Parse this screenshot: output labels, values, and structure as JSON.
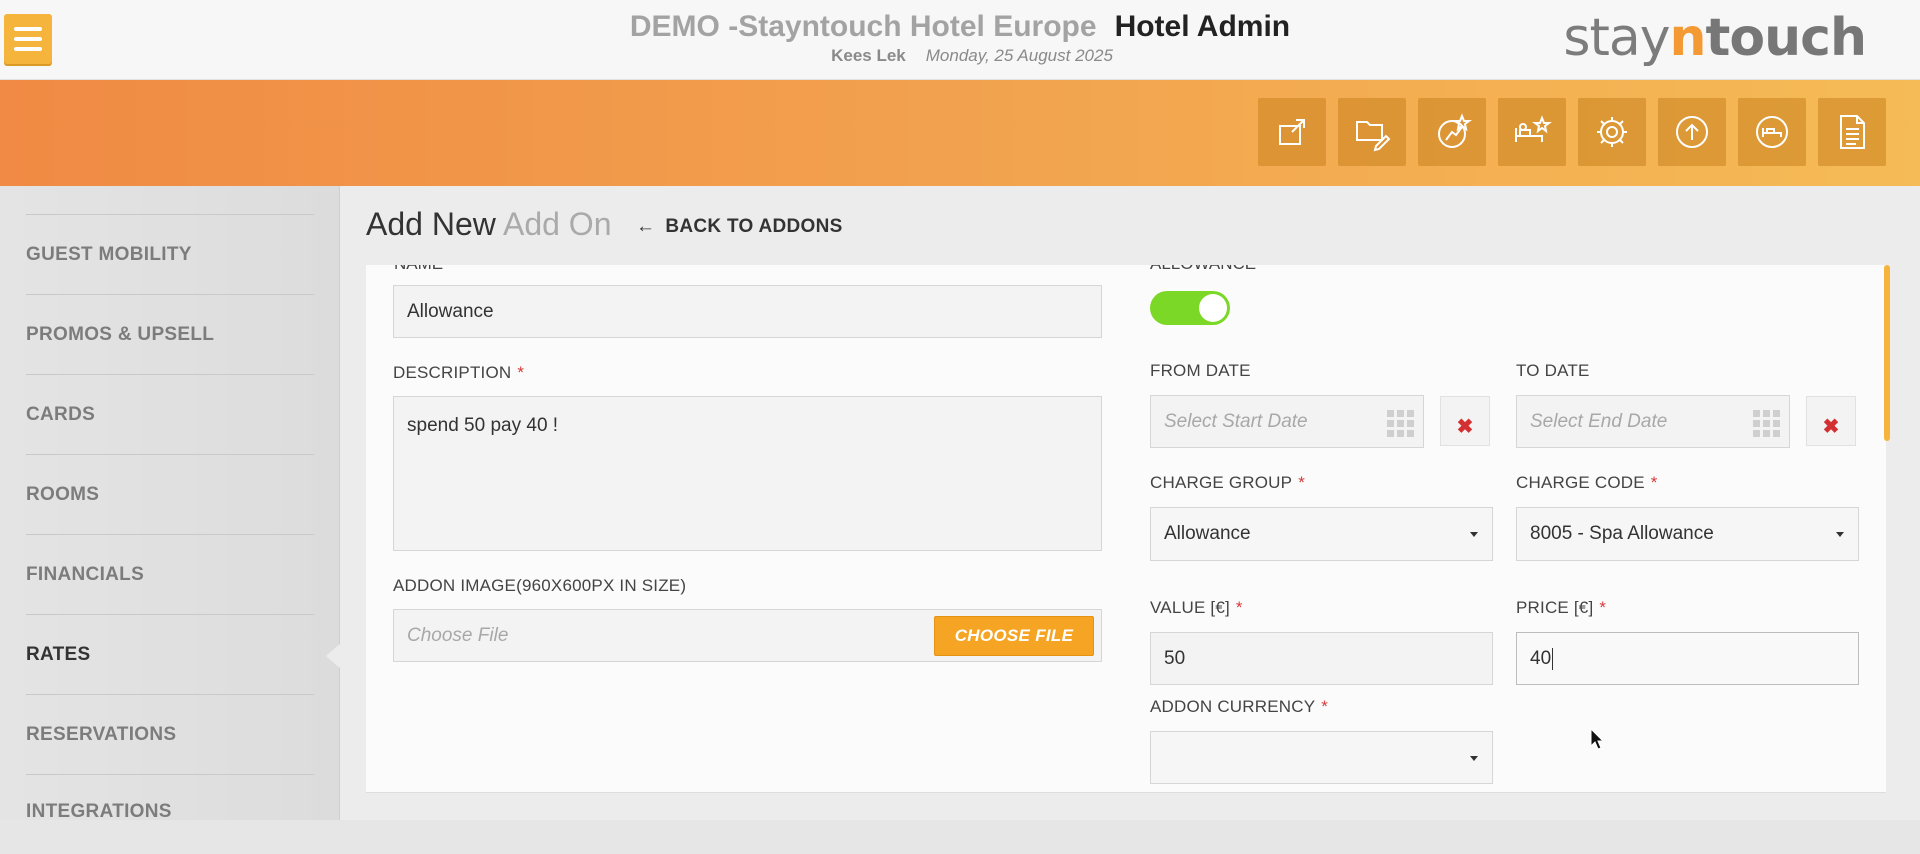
{
  "header": {
    "hotel_name": "DEMO -Stayntouch Hotel Europe",
    "app_name": "Hotel Admin",
    "user": "Kees Lek",
    "date": "Monday, 25 August 2025",
    "brand_pre": "stay",
    "brand_accent": "n",
    "brand_post": "touch"
  },
  "toolbar": {
    "icons": [
      "external-link-icon",
      "folder-edit-icon",
      "star-chart-icon",
      "bed-star-icon",
      "gear-icon",
      "upload-icon",
      "bed-circle-icon",
      "document-icon"
    ]
  },
  "sidebar": {
    "items": [
      {
        "label": "GUEST MOBILITY"
      },
      {
        "label": "PROMOS & UPSELL"
      },
      {
        "label": "CARDS"
      },
      {
        "label": "ROOMS"
      },
      {
        "label": "FINANCIALS"
      },
      {
        "label": "RATES"
      },
      {
        "label": "RESERVATIONS"
      },
      {
        "label": "INTEGRATIONS"
      }
    ],
    "active": "RATES"
  },
  "page": {
    "title_main": "Add New",
    "title_sub": "Add On",
    "back_label": "BACK TO ADDONS"
  },
  "form": {
    "name_label": "NAME",
    "name_value": "Allowance",
    "allowance_label": "ALLOWANCE",
    "allowance_on": true,
    "description_label": "DESCRIPTION",
    "description_value": "spend 50 pay 40 !",
    "image_label": "ADDON IMAGE(960X600PX IN SIZE)",
    "image_placeholder": "Choose File",
    "choose_file_label": "CHOOSE FILE",
    "from_date_label": "FROM DATE",
    "from_date_placeholder": "Select Start Date",
    "to_date_label": "TO DATE",
    "to_date_placeholder": "Select End Date",
    "clear_symbol": "✖",
    "charge_group_label": "CHARGE GROUP",
    "charge_group_value": "Allowance",
    "charge_code_label": "CHARGE CODE",
    "charge_code_value": "8005 - Spa Allowance",
    "value_label": "VALUE [€]",
    "value_value": "50",
    "price_label": "PRICE [€]",
    "price_value": "40",
    "currency_label": "ADDON CURRENCY",
    "currency_value": "",
    "required_mark": "*"
  },
  "colors": {
    "accent_orange": "#f5a523",
    "toggle_green": "#7cd826",
    "required_red": "#d43b3b"
  }
}
